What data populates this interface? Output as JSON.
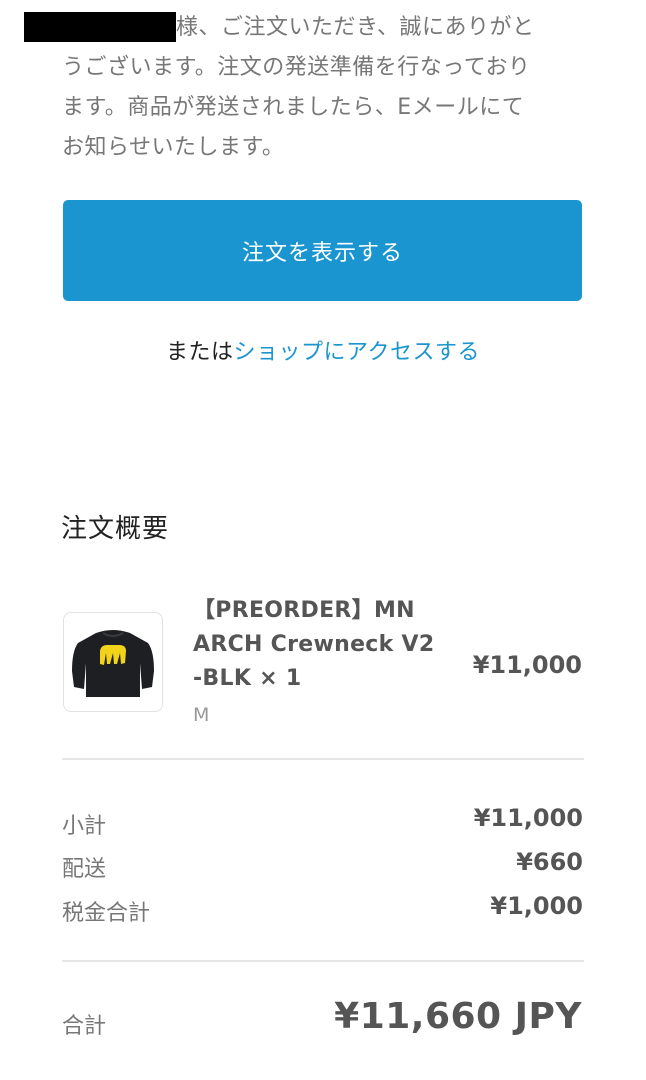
{
  "intro": {
    "lines": [
      "様、ご注文いただき、誠にありがと",
      "うございます。注文の発送準備を行なっており",
      "ます。商品が発送されましたら、Eメールにて",
      "お知らせいたします。"
    ]
  },
  "actions": {
    "view_order_label": "注文を表示する",
    "or_prefix": "または",
    "shop_link_label": "ショップにアクセスする"
  },
  "summary": {
    "title": "注文概要",
    "item": {
      "name_lines": [
        "【PREORDER】MN",
        "ARCH Crewneck V2",
        "-BLK × 1"
      ],
      "variant": "M",
      "price": "¥11,000",
      "image_icon": "crewneck-sweatshirt-image"
    },
    "rows": [
      {
        "label": "小計",
        "value": "¥11,000"
      },
      {
        "label": "配送",
        "value": "¥660"
      },
      {
        "label": "税金合計",
        "value": "¥1,000"
      }
    ],
    "total": {
      "label": "合計",
      "value": "¥11,660 JPY"
    }
  },
  "colors": {
    "accent": "#1b95d0",
    "muted_text": "#777777",
    "strong_text": "#555555",
    "divider": "#e6e6e6"
  }
}
